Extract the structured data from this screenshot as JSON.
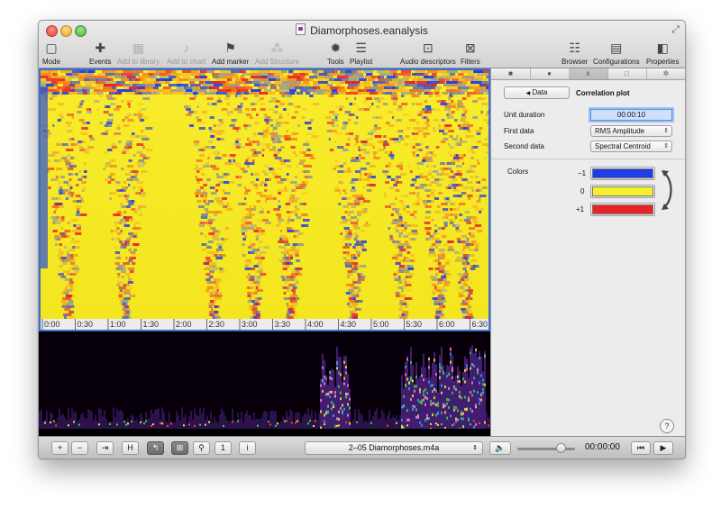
{
  "window": {
    "title": "Diamorphoses.eanalysis"
  },
  "toolbar": {
    "items": [
      {
        "label": "Mode",
        "icon": "mode-icon",
        "enabled": true
      },
      {
        "label": "Events",
        "icon": "plus-icon",
        "enabled": true
      },
      {
        "label": "Add to library",
        "icon": "library-icon",
        "enabled": false
      },
      {
        "label": "Add to chart",
        "icon": "chart-icon",
        "enabled": false
      },
      {
        "label": "Add marker",
        "icon": "marker-icon",
        "enabled": true
      },
      {
        "label": "Add Structure",
        "icon": "structure-icon",
        "enabled": false
      },
      {
        "label": "Tools",
        "icon": "gear-icon",
        "enabled": true
      },
      {
        "label": "Playlist",
        "icon": "list-icon",
        "enabled": true
      },
      {
        "label": "Audio descriptors",
        "icon": "waveform-icon",
        "enabled": true
      },
      {
        "label": "Filters",
        "icon": "filter-icon",
        "enabled": true
      },
      {
        "label": "Browser",
        "icon": "browser-icon",
        "enabled": true
      },
      {
        "label": "Configurations",
        "icon": "configurations-icon",
        "enabled": true
      },
      {
        "label": "Properties",
        "icon": "properties-icon",
        "enabled": true
      }
    ]
  },
  "timeline": {
    "ticks": [
      "0:00",
      "0:30",
      "1:00",
      "1:30",
      "2:00",
      "2:30",
      "3:00",
      "3:30",
      "4:00",
      "4:30",
      "5:00",
      "5:30",
      "6:00",
      "6:30"
    ]
  },
  "panel": {
    "tabs": [
      "square-icon",
      "eye-icon",
      "wave-icon",
      "frame-icon",
      "gear-icon"
    ],
    "back_button": "Data",
    "heading": "Correlation plot",
    "unit_duration_label": "Unit duration",
    "unit_duration_value": "00:00:10",
    "first_data_label": "First data",
    "first_data_value": "RMS Amplitude",
    "second_data_label": "Second data",
    "second_data_value": "Spectral Centroid",
    "colors_label": "Colors",
    "color_scale": [
      {
        "label": "−1",
        "color": "#1f3fe6"
      },
      {
        "label": "0",
        "color": "#f6f02a"
      },
      {
        "label": "+1",
        "color": "#e8242a"
      }
    ],
    "help": "?"
  },
  "bottombar": {
    "buttons": [
      "+",
      "−",
      "⇥",
      "H",
      "↰",
      "⊞",
      "⚲",
      "1",
      "i"
    ],
    "file": "2–05 Diamorphoses.m4a",
    "volume": 0.75,
    "time": "00:00:00"
  }
}
